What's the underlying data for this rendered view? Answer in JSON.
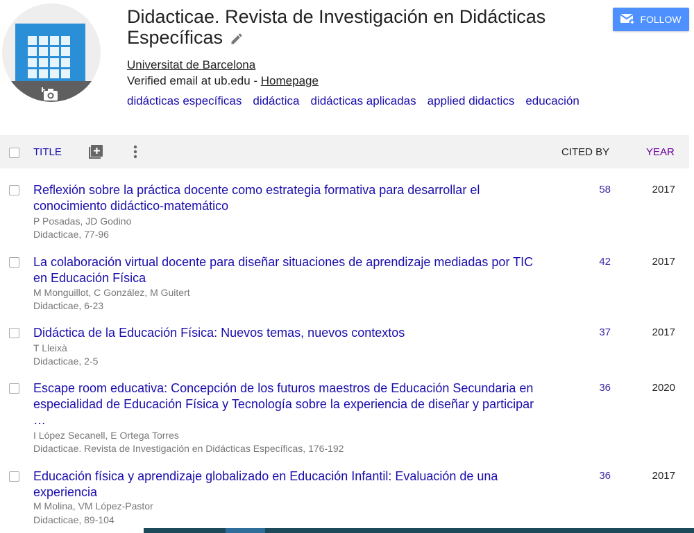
{
  "profile": {
    "name": "Didacticae. Revista de Investigación en Didácticas Específicas",
    "affiliation": "Universitat de Barcelona",
    "email_text": "Verified email at ub.edu - ",
    "homepage_label": "Homepage",
    "interests": [
      "didácticas específicas",
      "didáctica",
      "didácticas aplicadas",
      "applied didactics",
      "educación"
    ],
    "follow_label": "FOLLOW"
  },
  "table": {
    "title_header": "TITLE",
    "cited_header": "CITED BY",
    "year_header": "YEAR",
    "rows": [
      {
        "title": "Reflexión sobre la práctica docente como estrategia formativa para desarrollar el conocimiento didáctico-matemático",
        "authors": "P Posadas, JD Godino",
        "venue": "Didacticae, 77-96",
        "cited": "58",
        "year": "2017"
      },
      {
        "title": "La colaboración virtual docente para diseñar situaciones de aprendizaje mediadas por TIC en Educación Física",
        "authors": "M Monguillot, C González, M Guitert",
        "venue": "Didacticae, 6-23",
        "cited": "42",
        "year": "2017"
      },
      {
        "title": "Didáctica de la Educación Física: Nuevos temas, nuevos contextos",
        "authors": "T Lleixà",
        "venue": "Didacticae, 2-5",
        "cited": "37",
        "year": "2017"
      },
      {
        "title": "Escape room educativa: Concepción de los futuros maestros de Educación Secundaria en especialidad de Educación Física y Tecnología sobre la experiencia de diseñar y participar …",
        "authors": "I López Secanell, E Ortega Torres",
        "venue": "Didacticae. Revista de Investigación en Didácticas Específicas, 176-192",
        "cited": "36",
        "year": "2020"
      },
      {
        "title": "Educación física y aprendizaje globalizado en Educación Infantil: Evaluación de una experiencia",
        "authors": "M Molina, VM López-Pastor",
        "venue": "Didacticae, 89-104",
        "cited": "36",
        "year": "2017"
      }
    ]
  },
  "colors": {
    "link": "#1a0dab",
    "follow": "#4d90fe",
    "year_header": "#660099"
  }
}
